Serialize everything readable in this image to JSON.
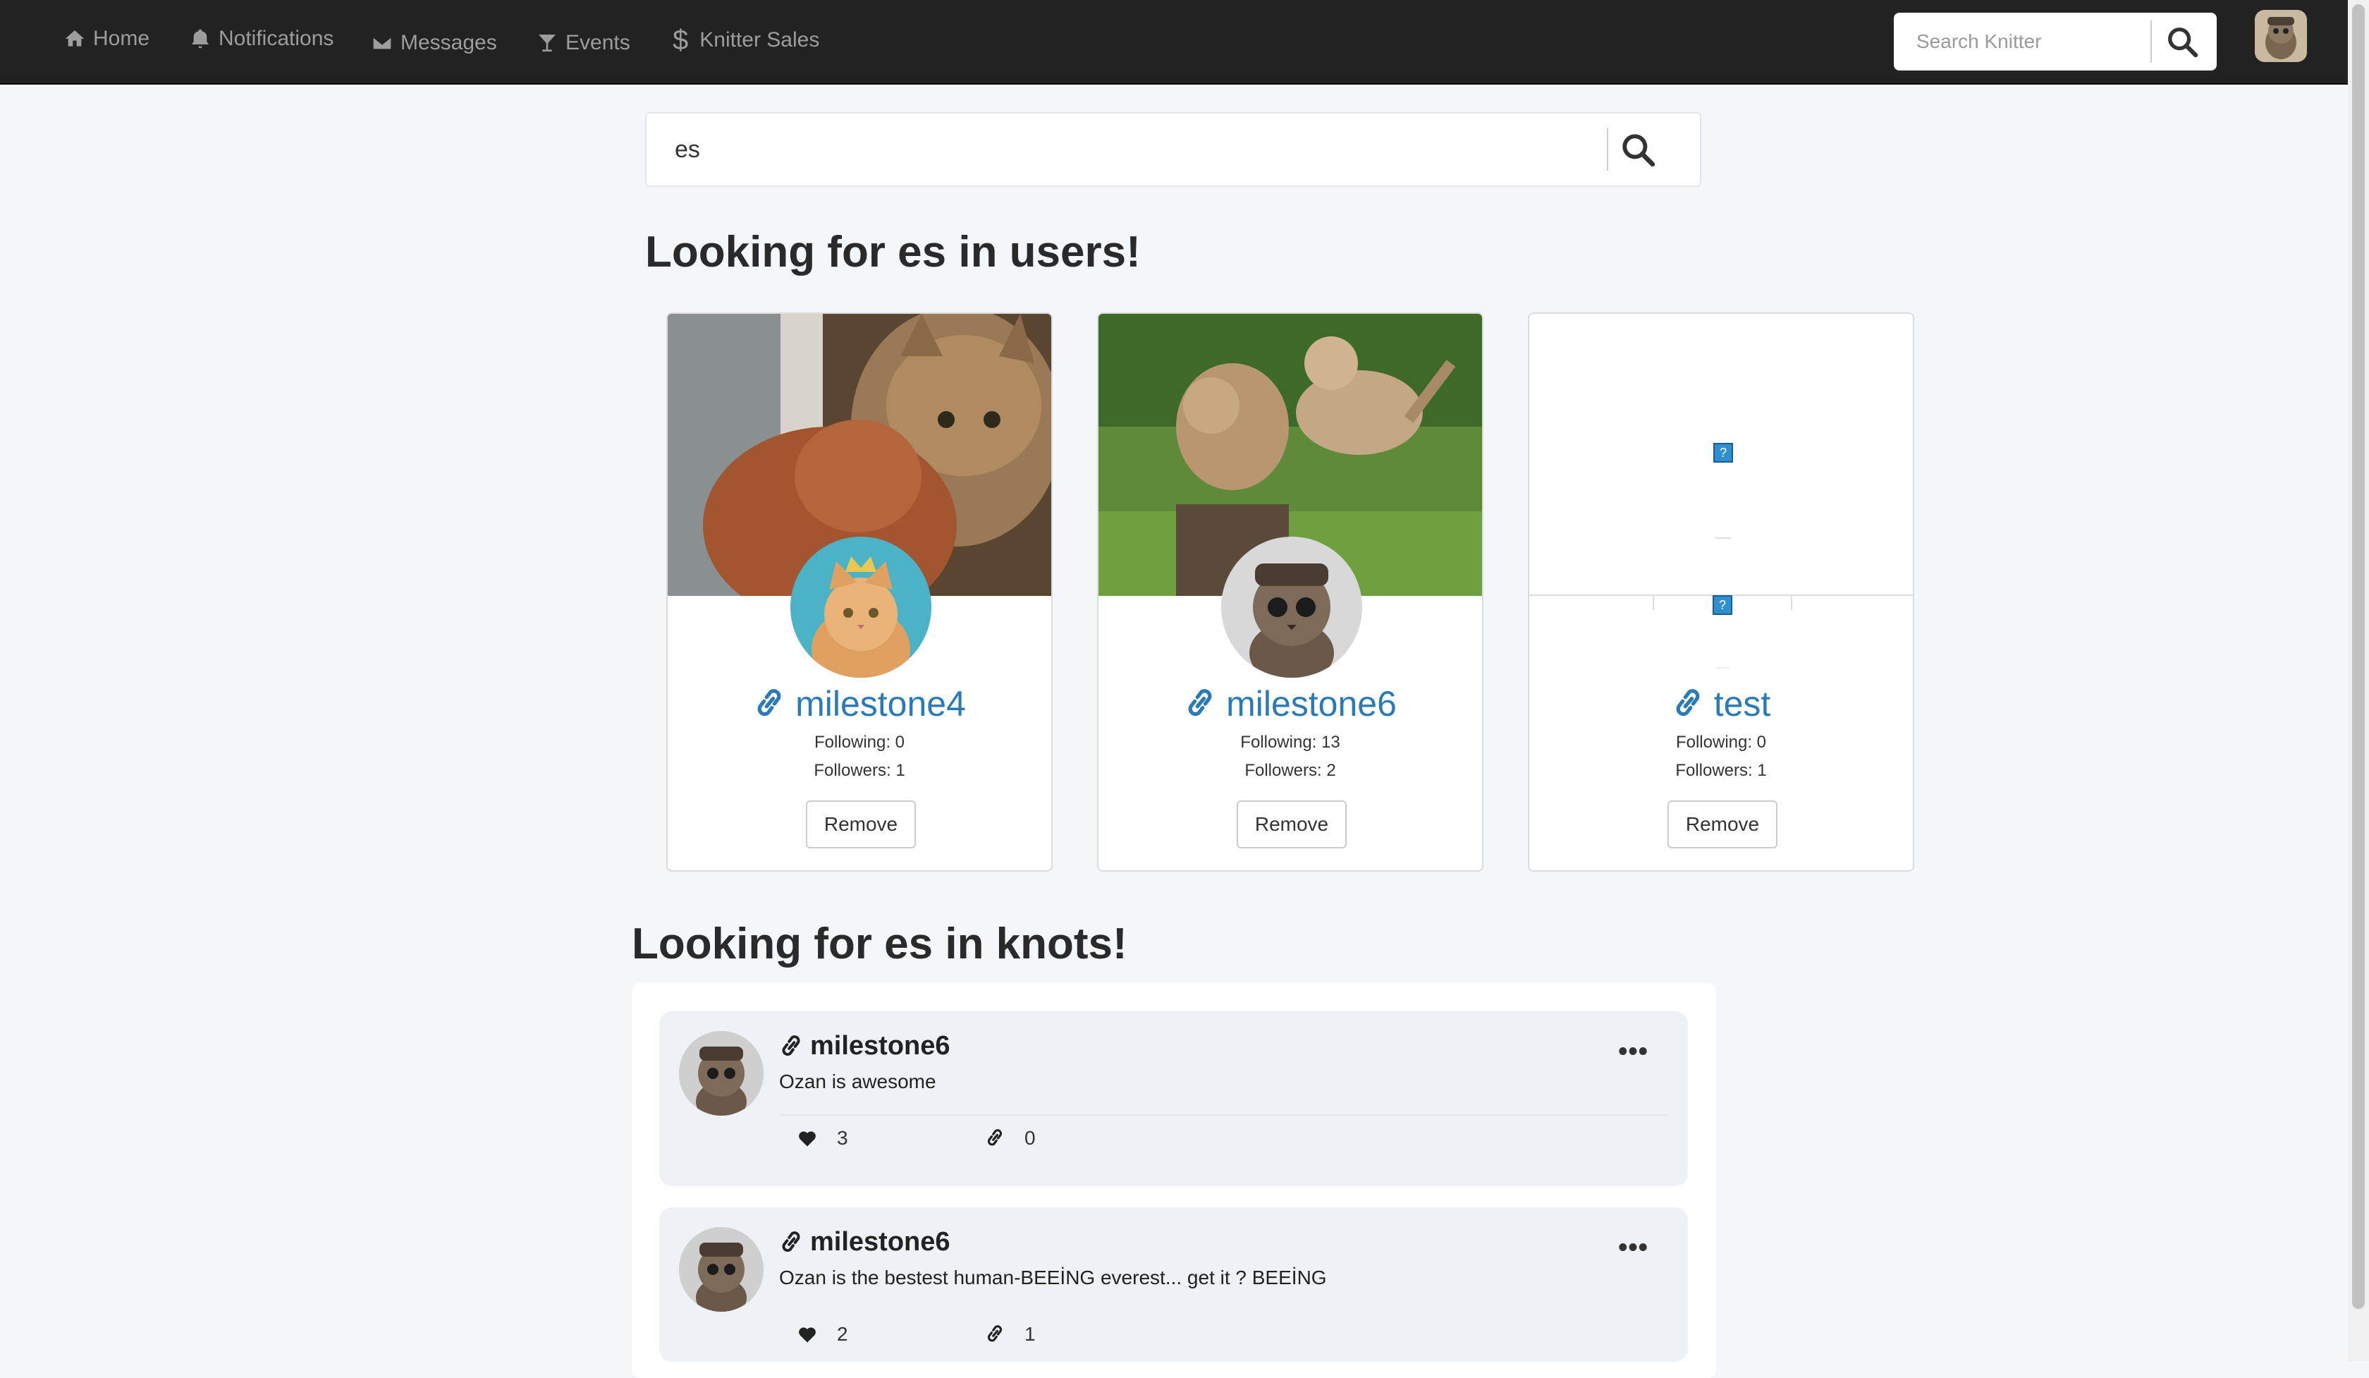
{
  "navbar": {
    "items": [
      {
        "label": "Home",
        "icon": "home-icon"
      },
      {
        "label": "Notifications",
        "icon": "bell-icon"
      },
      {
        "label": "Messages",
        "icon": "envelope-icon"
      },
      {
        "label": "Events",
        "icon": "glass-icon"
      },
      {
        "label": "Knitter Sales",
        "icon": "dollar-icon"
      }
    ],
    "search_placeholder": "Search Knitter"
  },
  "search": {
    "value": "es"
  },
  "users_heading": "Looking for es in users!",
  "users": [
    {
      "name": "milestone4",
      "following": "Following: 0",
      "followers": "Followers: 1",
      "remove_label": "Remove"
    },
    {
      "name": "milestone6",
      "following": "Following: 13",
      "followers": "Followers: 2",
      "remove_label": "Remove"
    },
    {
      "name": "test",
      "following": "Following: 0",
      "followers": "Followers: 1",
      "remove_label": "Remove"
    }
  ],
  "knots_heading": "Looking for es in knots!",
  "knots": [
    {
      "author": "milestone6",
      "text": "Ozan is awesome",
      "likes": "3",
      "reknots": "0",
      "more": "•••"
    },
    {
      "author": "milestone6",
      "text": "Ozan is the bestest human-BEEİNG everest... get it ? BEEİNG",
      "likes": "2",
      "reknots": "1",
      "more": "•••"
    }
  ],
  "colors": {
    "navbar": "#222222",
    "link": "#2a7ab8",
    "background": "#f4f7fa"
  }
}
